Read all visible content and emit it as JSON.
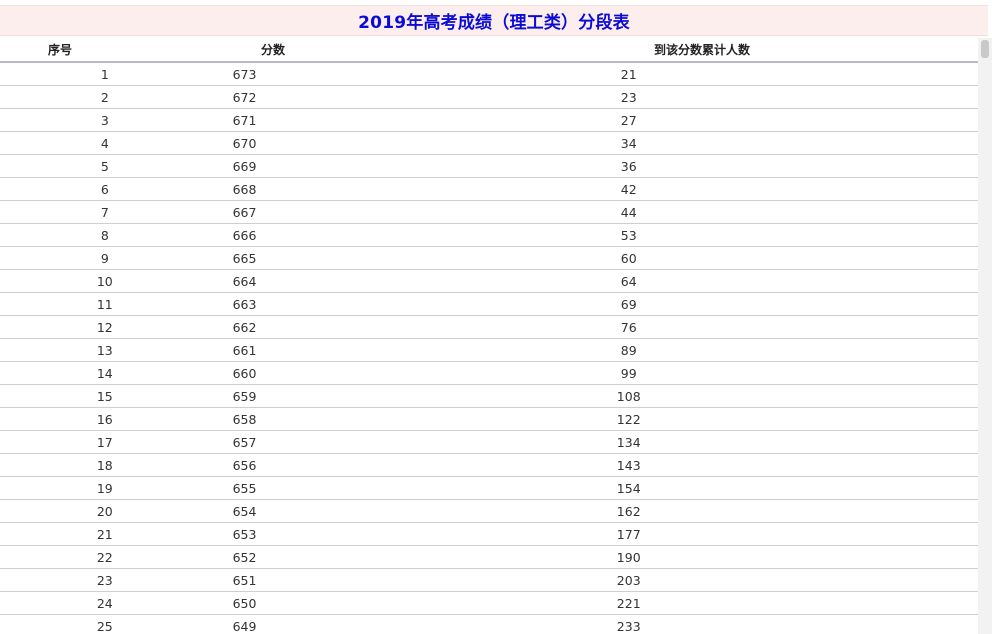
{
  "title": "2019年高考成绩（理工类）分段表",
  "headers": {
    "seq": "序号",
    "score": "分数",
    "cumulative": "到该分数累计人数"
  },
  "rows": [
    {
      "seq": "1",
      "score": "673",
      "cumulative": "21"
    },
    {
      "seq": "2",
      "score": "672",
      "cumulative": "23"
    },
    {
      "seq": "3",
      "score": "671",
      "cumulative": "27"
    },
    {
      "seq": "4",
      "score": "670",
      "cumulative": "34"
    },
    {
      "seq": "5",
      "score": "669",
      "cumulative": "36"
    },
    {
      "seq": "6",
      "score": "668",
      "cumulative": "42"
    },
    {
      "seq": "7",
      "score": "667",
      "cumulative": "44"
    },
    {
      "seq": "8",
      "score": "666",
      "cumulative": "53"
    },
    {
      "seq": "9",
      "score": "665",
      "cumulative": "60"
    },
    {
      "seq": "10",
      "score": "664",
      "cumulative": "64"
    },
    {
      "seq": "11",
      "score": "663",
      "cumulative": "69"
    },
    {
      "seq": "12",
      "score": "662",
      "cumulative": "76"
    },
    {
      "seq": "13",
      "score": "661",
      "cumulative": "89"
    },
    {
      "seq": "14",
      "score": "660",
      "cumulative": "99"
    },
    {
      "seq": "15",
      "score": "659",
      "cumulative": "108"
    },
    {
      "seq": "16",
      "score": "658",
      "cumulative": "122"
    },
    {
      "seq": "17",
      "score": "657",
      "cumulative": "134"
    },
    {
      "seq": "18",
      "score": "656",
      "cumulative": "143"
    },
    {
      "seq": "19",
      "score": "655",
      "cumulative": "154"
    },
    {
      "seq": "20",
      "score": "654",
      "cumulative": "162"
    },
    {
      "seq": "21",
      "score": "653",
      "cumulative": "177"
    },
    {
      "seq": "22",
      "score": "652",
      "cumulative": "190"
    },
    {
      "seq": "23",
      "score": "651",
      "cumulative": "203"
    },
    {
      "seq": "24",
      "score": "650",
      "cumulative": "221"
    },
    {
      "seq": "25",
      "score": "649",
      "cumulative": "233"
    }
  ],
  "colors": {
    "title_text": "#0b0bd6",
    "title_background": "#fdeeee"
  }
}
